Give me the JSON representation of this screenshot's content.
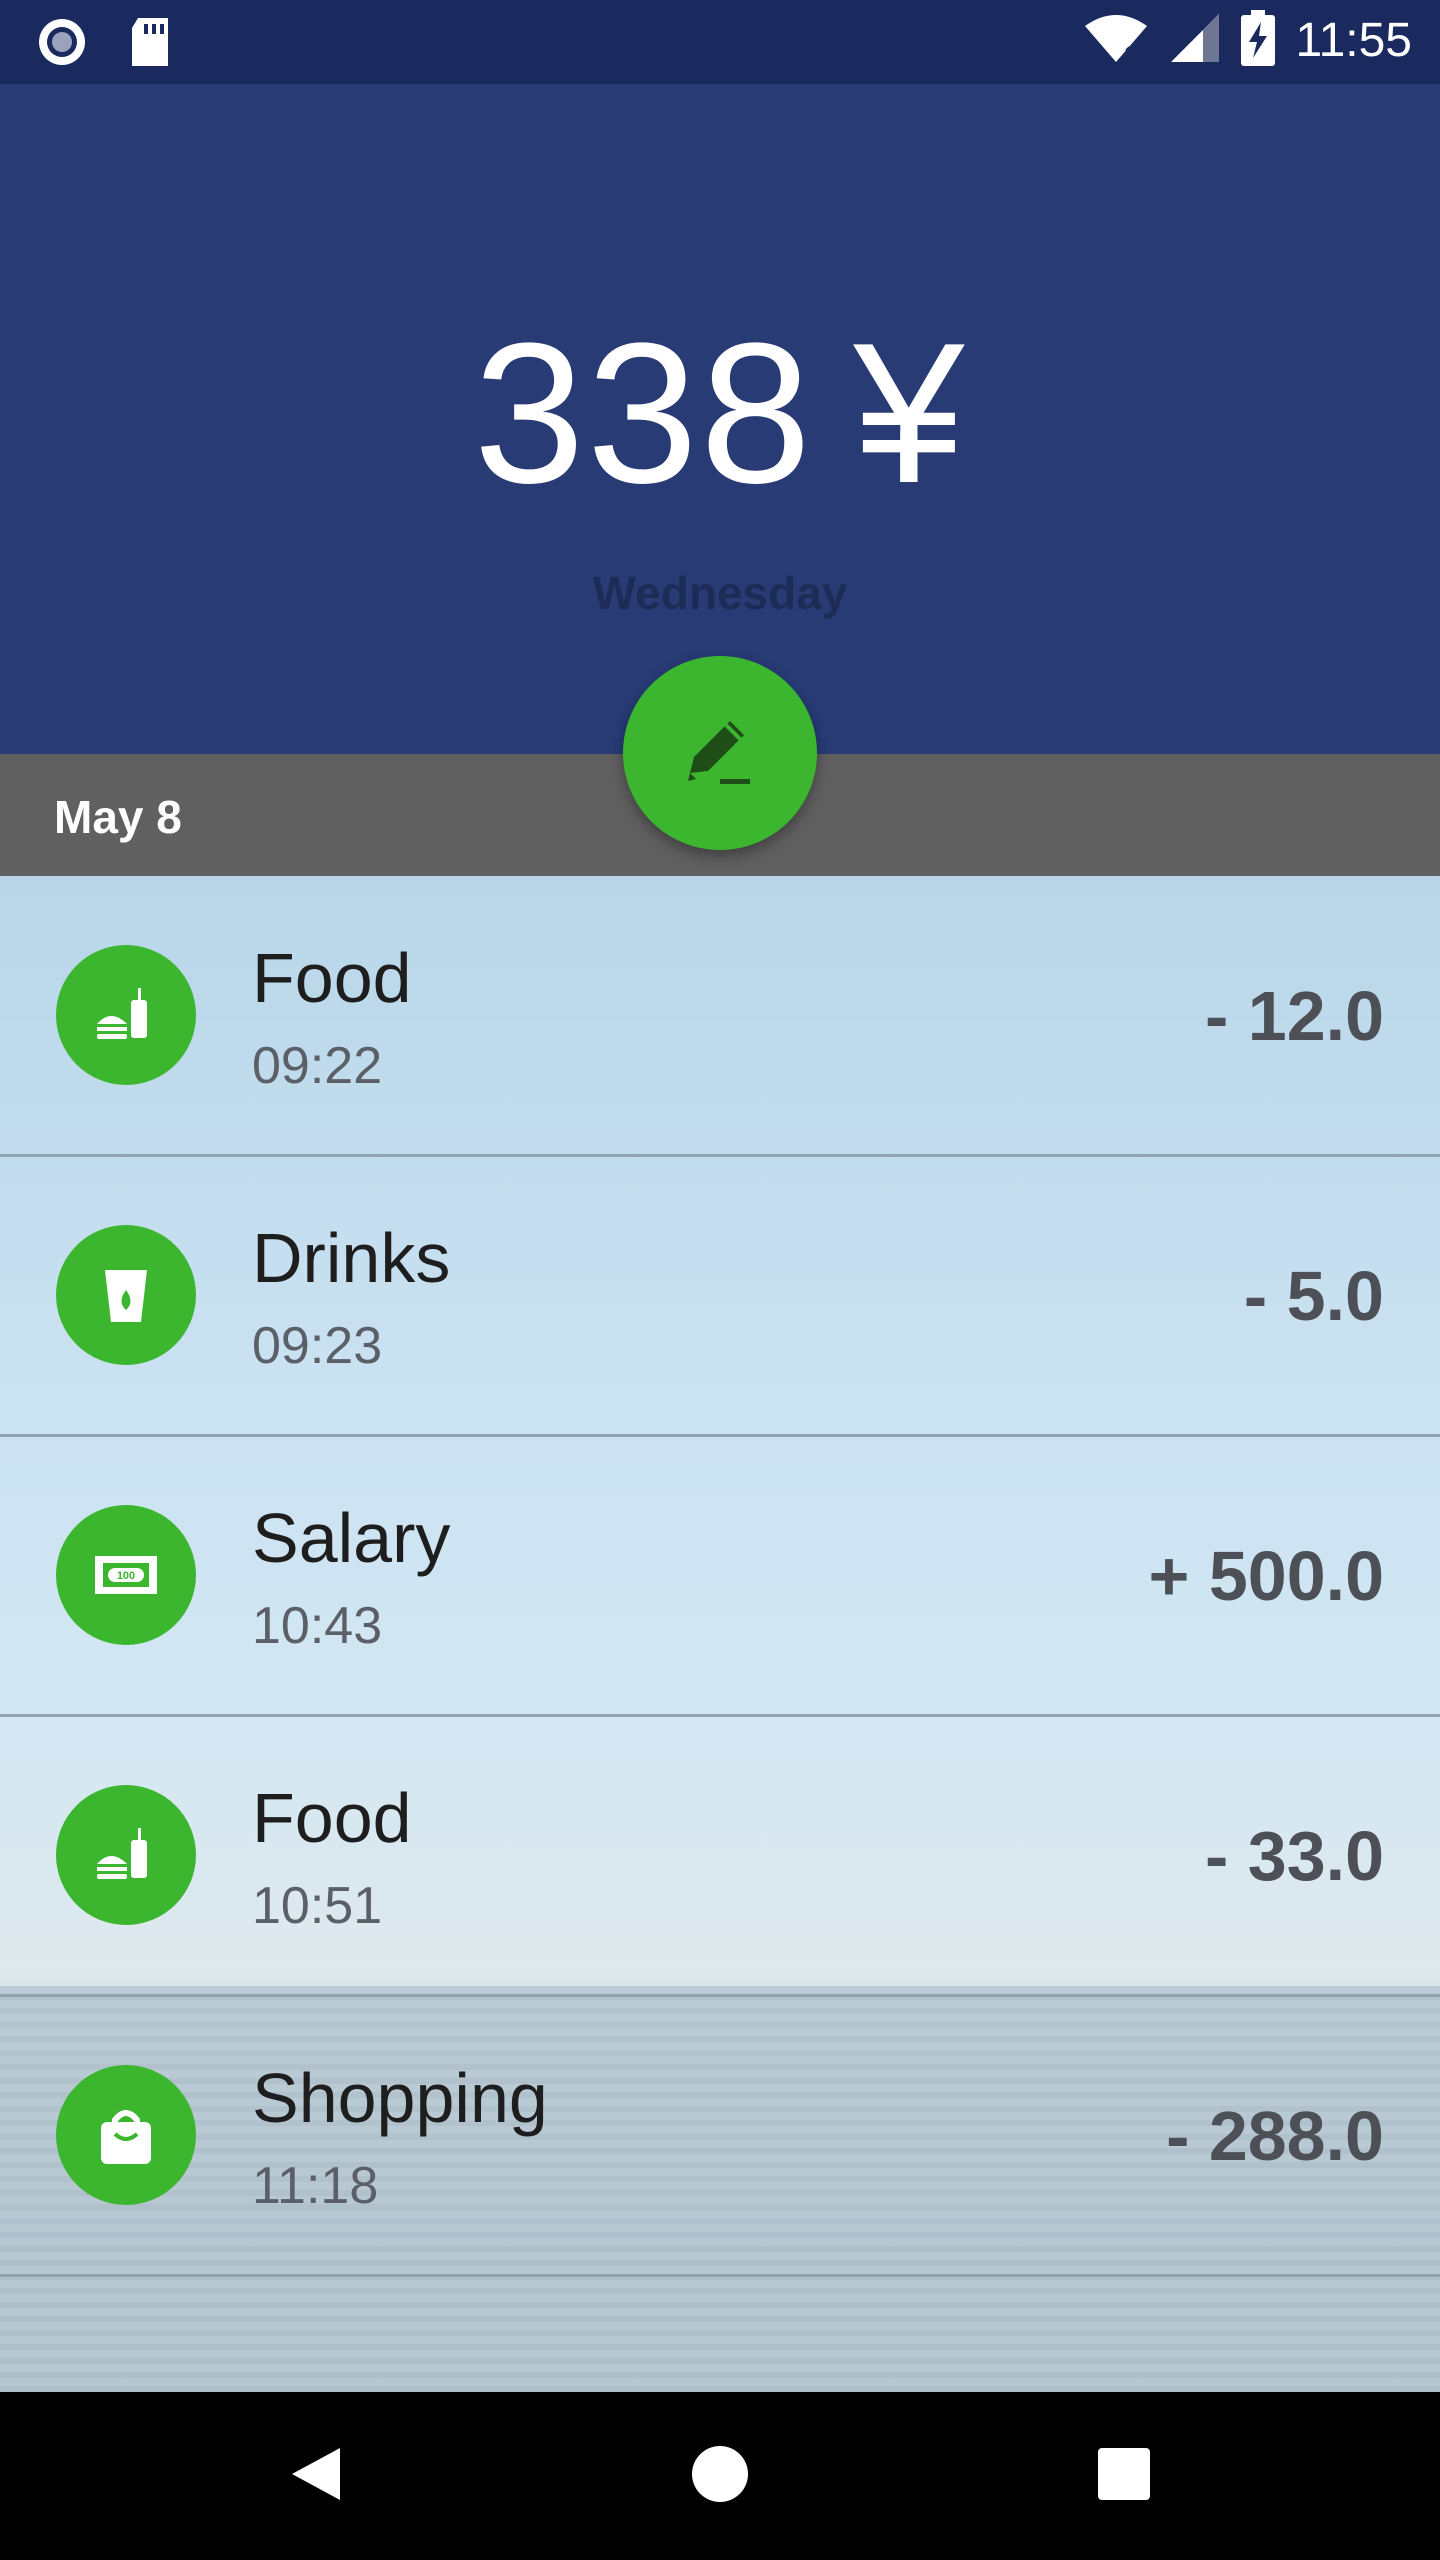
{
  "status_bar": {
    "time": "11:55",
    "left_icons": [
      "record-icon",
      "sd-card-icon"
    ],
    "right_icons": [
      "wifi-icon",
      "signal-icon",
      "battery-charging-icon"
    ]
  },
  "header": {
    "total_amount": "338",
    "currency": "¥",
    "day": "Wednesday",
    "background_color": "#283b75"
  },
  "fab": {
    "icon": "edit-icon",
    "color": "#3cb62f"
  },
  "date_group": {
    "label": "May 8"
  },
  "transactions": [
    {
      "category": "Food",
      "time": "09:22",
      "amount": "- 12.0",
      "icon": "food-icon"
    },
    {
      "category": "Drinks",
      "time": "09:23",
      "amount": "- 5.0",
      "icon": "drink-icon"
    },
    {
      "category": "Salary",
      "time": "10:43",
      "amount": "+ 500.0",
      "icon": "money-icon"
    },
    {
      "category": "Food",
      "time": "10:51",
      "amount": "- 33.0",
      "icon": "food-icon"
    },
    {
      "category": "Shopping",
      "time": "11:18",
      "amount": "- 288.0",
      "icon": "shopping-bag-icon"
    }
  ],
  "nav_bar": {
    "buttons": [
      "back-icon",
      "home-icon",
      "recents-icon"
    ]
  }
}
